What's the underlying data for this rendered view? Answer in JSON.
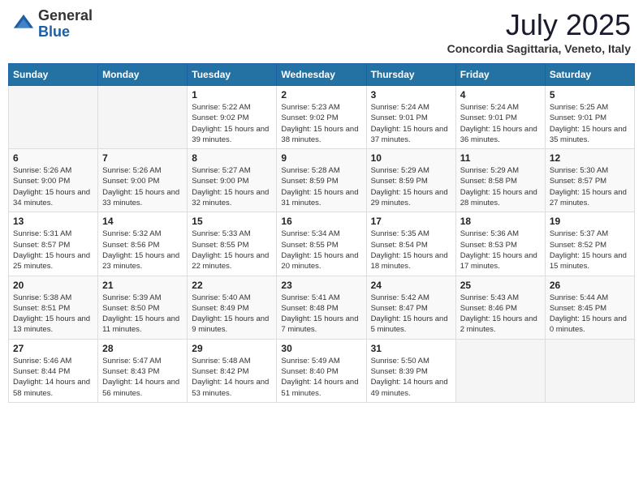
{
  "header": {
    "logo_general": "General",
    "logo_blue": "Blue",
    "month": "July 2025",
    "location": "Concordia Sagittaria, Veneto, Italy"
  },
  "weekdays": [
    "Sunday",
    "Monday",
    "Tuesday",
    "Wednesday",
    "Thursday",
    "Friday",
    "Saturday"
  ],
  "weeks": [
    [
      {
        "day": "",
        "info": ""
      },
      {
        "day": "",
        "info": ""
      },
      {
        "day": "1",
        "info": "Sunrise: 5:22 AM\nSunset: 9:02 PM\nDaylight: 15 hours and 39 minutes."
      },
      {
        "day": "2",
        "info": "Sunrise: 5:23 AM\nSunset: 9:02 PM\nDaylight: 15 hours and 38 minutes."
      },
      {
        "day": "3",
        "info": "Sunrise: 5:24 AM\nSunset: 9:01 PM\nDaylight: 15 hours and 37 minutes."
      },
      {
        "day": "4",
        "info": "Sunrise: 5:24 AM\nSunset: 9:01 PM\nDaylight: 15 hours and 36 minutes."
      },
      {
        "day": "5",
        "info": "Sunrise: 5:25 AM\nSunset: 9:01 PM\nDaylight: 15 hours and 35 minutes."
      }
    ],
    [
      {
        "day": "6",
        "info": "Sunrise: 5:26 AM\nSunset: 9:00 PM\nDaylight: 15 hours and 34 minutes."
      },
      {
        "day": "7",
        "info": "Sunrise: 5:26 AM\nSunset: 9:00 PM\nDaylight: 15 hours and 33 minutes."
      },
      {
        "day": "8",
        "info": "Sunrise: 5:27 AM\nSunset: 9:00 PM\nDaylight: 15 hours and 32 minutes."
      },
      {
        "day": "9",
        "info": "Sunrise: 5:28 AM\nSunset: 8:59 PM\nDaylight: 15 hours and 31 minutes."
      },
      {
        "day": "10",
        "info": "Sunrise: 5:29 AM\nSunset: 8:59 PM\nDaylight: 15 hours and 29 minutes."
      },
      {
        "day": "11",
        "info": "Sunrise: 5:29 AM\nSunset: 8:58 PM\nDaylight: 15 hours and 28 minutes."
      },
      {
        "day": "12",
        "info": "Sunrise: 5:30 AM\nSunset: 8:57 PM\nDaylight: 15 hours and 27 minutes."
      }
    ],
    [
      {
        "day": "13",
        "info": "Sunrise: 5:31 AM\nSunset: 8:57 PM\nDaylight: 15 hours and 25 minutes."
      },
      {
        "day": "14",
        "info": "Sunrise: 5:32 AM\nSunset: 8:56 PM\nDaylight: 15 hours and 23 minutes."
      },
      {
        "day": "15",
        "info": "Sunrise: 5:33 AM\nSunset: 8:55 PM\nDaylight: 15 hours and 22 minutes."
      },
      {
        "day": "16",
        "info": "Sunrise: 5:34 AM\nSunset: 8:55 PM\nDaylight: 15 hours and 20 minutes."
      },
      {
        "day": "17",
        "info": "Sunrise: 5:35 AM\nSunset: 8:54 PM\nDaylight: 15 hours and 18 minutes."
      },
      {
        "day": "18",
        "info": "Sunrise: 5:36 AM\nSunset: 8:53 PM\nDaylight: 15 hours and 17 minutes."
      },
      {
        "day": "19",
        "info": "Sunrise: 5:37 AM\nSunset: 8:52 PM\nDaylight: 15 hours and 15 minutes."
      }
    ],
    [
      {
        "day": "20",
        "info": "Sunrise: 5:38 AM\nSunset: 8:51 PM\nDaylight: 15 hours and 13 minutes."
      },
      {
        "day": "21",
        "info": "Sunrise: 5:39 AM\nSunset: 8:50 PM\nDaylight: 15 hours and 11 minutes."
      },
      {
        "day": "22",
        "info": "Sunrise: 5:40 AM\nSunset: 8:49 PM\nDaylight: 15 hours and 9 minutes."
      },
      {
        "day": "23",
        "info": "Sunrise: 5:41 AM\nSunset: 8:48 PM\nDaylight: 15 hours and 7 minutes."
      },
      {
        "day": "24",
        "info": "Sunrise: 5:42 AM\nSunset: 8:47 PM\nDaylight: 15 hours and 5 minutes."
      },
      {
        "day": "25",
        "info": "Sunrise: 5:43 AM\nSunset: 8:46 PM\nDaylight: 15 hours and 2 minutes."
      },
      {
        "day": "26",
        "info": "Sunrise: 5:44 AM\nSunset: 8:45 PM\nDaylight: 15 hours and 0 minutes."
      }
    ],
    [
      {
        "day": "27",
        "info": "Sunrise: 5:46 AM\nSunset: 8:44 PM\nDaylight: 14 hours and 58 minutes."
      },
      {
        "day": "28",
        "info": "Sunrise: 5:47 AM\nSunset: 8:43 PM\nDaylight: 14 hours and 56 minutes."
      },
      {
        "day": "29",
        "info": "Sunrise: 5:48 AM\nSunset: 8:42 PM\nDaylight: 14 hours and 53 minutes."
      },
      {
        "day": "30",
        "info": "Sunrise: 5:49 AM\nSunset: 8:40 PM\nDaylight: 14 hours and 51 minutes."
      },
      {
        "day": "31",
        "info": "Sunrise: 5:50 AM\nSunset: 8:39 PM\nDaylight: 14 hours and 49 minutes."
      },
      {
        "day": "",
        "info": ""
      },
      {
        "day": "",
        "info": ""
      }
    ]
  ]
}
